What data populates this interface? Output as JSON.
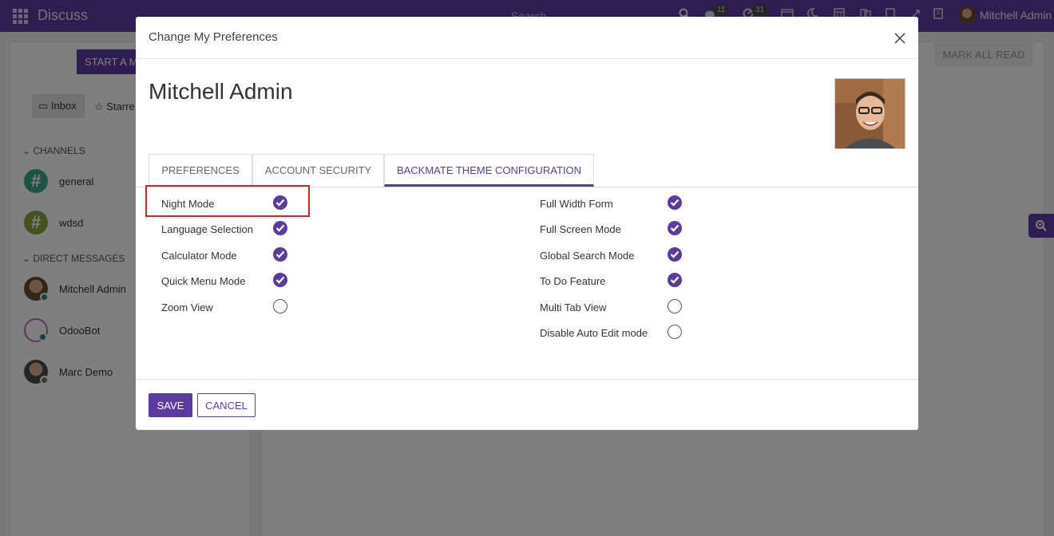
{
  "navbar": {
    "app_title": "Discuss",
    "search_placeholder": "Search",
    "chat_count": "11",
    "activity_count": "31",
    "user_name": "Mitchell Admin"
  },
  "background": {
    "start_meeting": "START A M",
    "inbox": "Inbox",
    "starred": "Starre",
    "channels_heading": "CHANNELS",
    "channels": [
      "general",
      "wdsd"
    ],
    "direct_heading": "DIRECT MESSAGES",
    "direct_messages": [
      "Mitchell Admin",
      "OdooBot",
      "Marc Demo"
    ],
    "mark_all_read": "MARK ALL READ"
  },
  "modal": {
    "title": "Change My Preferences",
    "record_name": "Mitchell Admin",
    "tabs": [
      "PREFERENCES",
      "ACCOUNT SECURITY",
      "BACKMATE THEME CONFIGURATION"
    ],
    "active_tab": "BACKMATE THEME CONFIGURATION",
    "left_fields": [
      {
        "label": "Night Mode",
        "checked": true
      },
      {
        "label": "Language Selection",
        "checked": true
      },
      {
        "label": "Calculator Mode",
        "checked": true
      },
      {
        "label": "Quick Menu Mode",
        "checked": true
      },
      {
        "label": "Zoom View",
        "checked": false
      }
    ],
    "right_fields": [
      {
        "label": "Full Width Form",
        "checked": true
      },
      {
        "label": "Full Screen Mode",
        "checked": true
      },
      {
        "label": "Global Search Mode",
        "checked": true
      },
      {
        "label": "To Do Feature",
        "checked": true
      },
      {
        "label": "Multi Tab View",
        "checked": false
      },
      {
        "label": "Disable Auto Edit mode",
        "checked": false
      }
    ],
    "save_label": "SAVE",
    "cancel_label": "CANCEL"
  },
  "colors": {
    "brand": "#5b3ba0",
    "highlight": "#e02020"
  }
}
